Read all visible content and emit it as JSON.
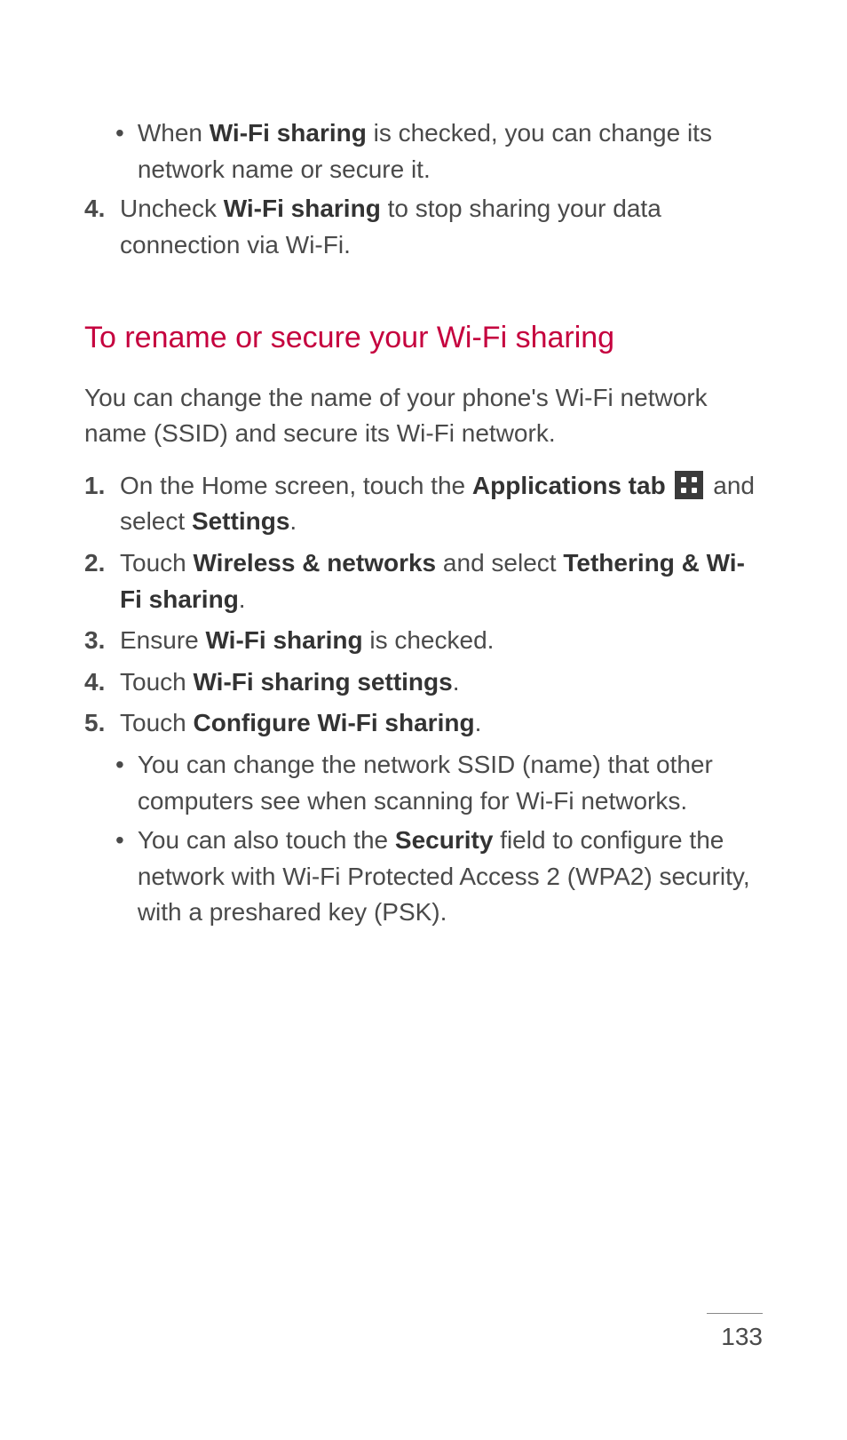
{
  "top_bullet": {
    "prefix": "When ",
    "bold1": "Wi-Fi sharing",
    "suffix": " is checked, you can change its network name or secure it."
  },
  "step4_top": {
    "num": "4.",
    "prefix": "Uncheck ",
    "bold1": "Wi-Fi sharing",
    "suffix": " to stop sharing your data connection via Wi-Fi."
  },
  "heading": "To rename or secure your Wi-Fi sharing",
  "intro": "You can change the name of your phone's Wi-Fi network name (SSID) and secure its Wi-Fi network.",
  "step1": {
    "num": "1.",
    "prefix": "On the Home screen, touch the ",
    "bold1": "Applications tab",
    "mid": " and select ",
    "bold2": "Settings",
    "suffix": "."
  },
  "step2": {
    "num": "2.",
    "prefix": "Touch ",
    "bold1": "Wireless & networks",
    "mid": " and select ",
    "bold2": "Tethering & Wi-Fi sharing",
    "suffix": "."
  },
  "step3": {
    "num": "3.",
    "prefix": "Ensure ",
    "bold1": "Wi-Fi sharing",
    "suffix": " is checked."
  },
  "step4": {
    "num": "4.",
    "prefix": "Touch ",
    "bold1": "Wi-Fi sharing settings",
    "suffix": "."
  },
  "step5": {
    "num": "5.",
    "prefix": "Touch ",
    "bold1": "Configure Wi-Fi sharing",
    "suffix": "."
  },
  "sub_bullet_a": "You can change the network SSID (name) that other computers see when scanning for Wi-Fi networks.",
  "sub_bullet_b": {
    "prefix": "You can also touch the ",
    "bold1": "Security",
    "suffix": " field to configure the network with Wi-Fi Protected Access 2 (WPA2) security, with a preshared key (PSK)."
  },
  "page_number": "133"
}
